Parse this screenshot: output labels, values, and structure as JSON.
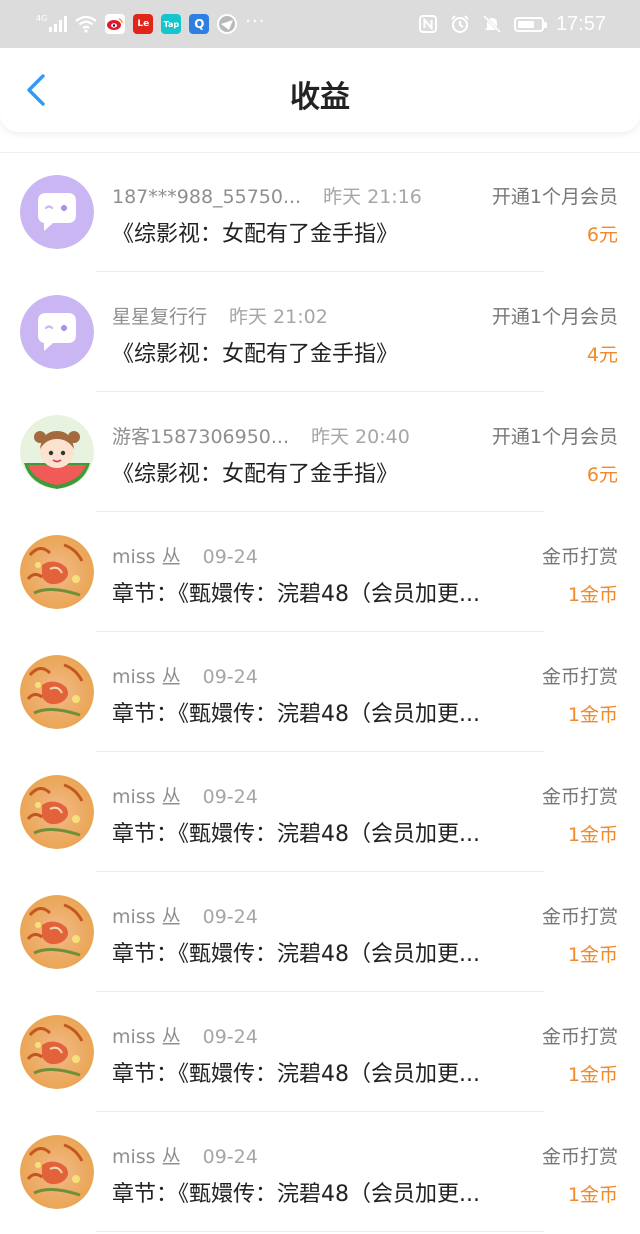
{
  "status_bar": {
    "network": "4G",
    "time": "17:57",
    "more": "···",
    "battery_level": 0.75,
    "app_icons": [
      "weibo-icon",
      "letv-icon",
      "taptap-icon",
      "search-app-icon",
      "browser-icon"
    ],
    "app_labels": {
      "letv": "Le",
      "taptap": "Tap",
      "search": "Q"
    }
  },
  "header": {
    "title": "收益"
  },
  "items": [
    {
      "user": "187***988_55750...",
      "time": "昨天 21:16",
      "content": "《综影视：女配有了金手指》",
      "type": "开通1个月会员",
      "amount": "6元",
      "avatar": "chat-default"
    },
    {
      "user": "星星复行行",
      "time": "昨天 21:02",
      "content": "《综影视：女配有了金手指》",
      "type": "开通1个月会员",
      "amount": "4元",
      "avatar": "chat-default"
    },
    {
      "user": "游客1587306950...",
      "time": "昨天 20:40",
      "content": "《综影视：女配有了金手指》",
      "type": "开通1个月会员",
      "amount": "6元",
      "avatar": "cartoon-girl"
    },
    {
      "user": "miss 丛",
      "time": "09-24",
      "content": "章节：《甄嬛传：浣碧48（会员加更...",
      "type": "金币打赏",
      "amount": "1金币",
      "avatar": "painting"
    },
    {
      "user": "miss 丛",
      "time": "09-24",
      "content": "章节：《甄嬛传：浣碧48（会员加更...",
      "type": "金币打赏",
      "amount": "1金币",
      "avatar": "painting"
    },
    {
      "user": "miss 丛",
      "time": "09-24",
      "content": "章节：《甄嬛传：浣碧48（会员加更...",
      "type": "金币打赏",
      "amount": "1金币",
      "avatar": "painting"
    },
    {
      "user": "miss 丛",
      "time": "09-24",
      "content": "章节：《甄嬛传：浣碧48（会员加更...",
      "type": "金币打赏",
      "amount": "1金币",
      "avatar": "painting"
    },
    {
      "user": "miss 丛",
      "time": "09-24",
      "content": "章节：《甄嬛传：浣碧48（会员加更...",
      "type": "金币打赏",
      "amount": "1金币",
      "avatar": "painting"
    },
    {
      "user": "miss 丛",
      "time": "09-24",
      "content": "章节：《甄嬛传：浣碧48（会员加更...",
      "type": "金币打赏",
      "amount": "1金币",
      "avatar": "painting"
    }
  ],
  "colors": {
    "accent": "#2f9bf5",
    "amount": "#f08a2a",
    "avatar_default": "#c9b6f2",
    "status_bar": "#dcdcdc"
  }
}
